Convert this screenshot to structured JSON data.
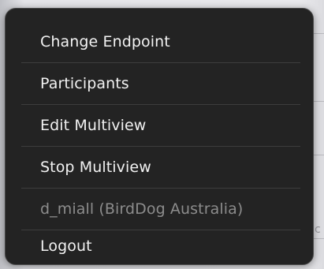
{
  "menu": {
    "items": [
      {
        "label": "Change Endpoint",
        "enabled": true
      },
      {
        "label": "Participants",
        "enabled": true
      },
      {
        "label": "Edit Multiview",
        "enabled": true
      },
      {
        "label": "Stop Multiview",
        "enabled": true
      },
      {
        "label": "d_miall (BirdDog Australia)",
        "enabled": false
      },
      {
        "label": "Logout",
        "enabled": true
      }
    ]
  },
  "colors": {
    "menu_background": "#232323",
    "menu_border": "#4a4a4a",
    "item_text": "#f2f2f2",
    "item_text_disabled": "#8c8c8c"
  }
}
